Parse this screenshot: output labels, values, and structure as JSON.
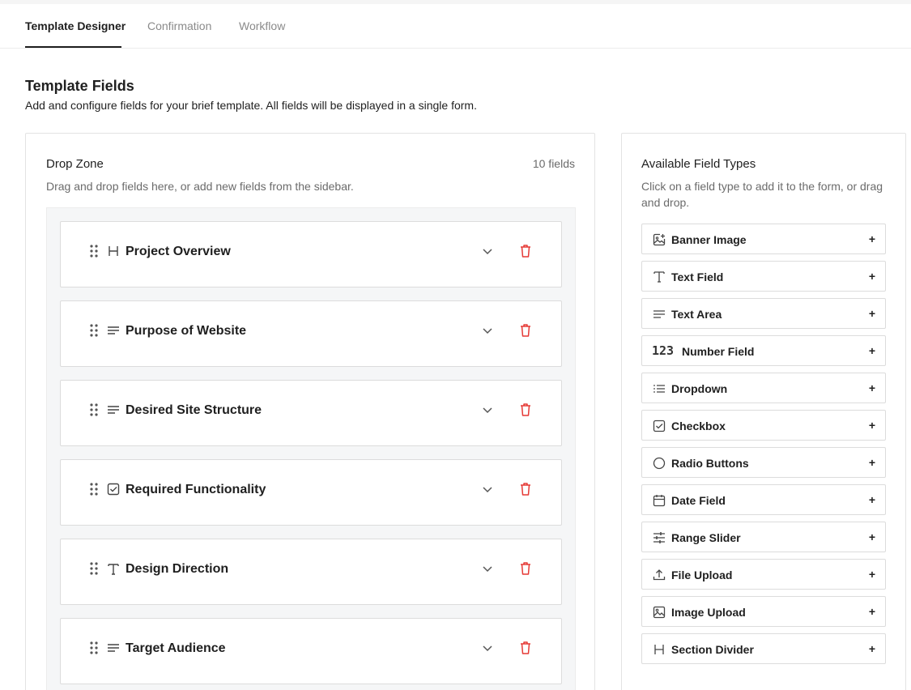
{
  "tabs": [
    {
      "label": "Template Designer",
      "active": true
    },
    {
      "label": "Confirmation",
      "active": false
    },
    {
      "label": "Workflow",
      "active": false
    }
  ],
  "header": {
    "title": "Template Fields",
    "subtitle": "Add and configure fields for your brief template. All fields will be displayed in a single form."
  },
  "drop_zone": {
    "title": "Drop Zone",
    "count": "10 fields",
    "description": "Drag and drop fields here, or add new fields from the sidebar.",
    "fields": [
      {
        "label": "Project Overview",
        "icon": "heading-icon"
      },
      {
        "label": "Purpose of Website",
        "icon": "text-area-icon"
      },
      {
        "label": "Desired Site Structure",
        "icon": "text-area-icon"
      },
      {
        "label": "Required Functionality",
        "icon": "checkbox-icon"
      },
      {
        "label": "Design Direction",
        "icon": "text-field-icon"
      },
      {
        "label": "Target Audience",
        "icon": "text-area-icon"
      }
    ]
  },
  "field_types": {
    "title": "Available Field Types",
    "description": "Click on a field type to add it to the form, or drag and drop.",
    "add_symbol": "+",
    "items": [
      {
        "label": "Banner Image",
        "icon": "banner-image-icon"
      },
      {
        "label": "Text Field",
        "icon": "text-field-icon"
      },
      {
        "label": "Text Area",
        "icon": "text-area-icon"
      },
      {
        "label": "Number Field",
        "icon": "number-icon",
        "icon_text": "123"
      },
      {
        "label": "Dropdown",
        "icon": "list-icon"
      },
      {
        "label": "Checkbox",
        "icon": "checkbox-icon"
      },
      {
        "label": "Radio Buttons",
        "icon": "radio-icon"
      },
      {
        "label": "Date Field",
        "icon": "calendar-icon"
      },
      {
        "label": "Range Slider",
        "icon": "sliders-icon"
      },
      {
        "label": "File Upload",
        "icon": "upload-icon"
      },
      {
        "label": "Image Upload",
        "icon": "image-icon"
      },
      {
        "label": "Section Divider",
        "icon": "heading-icon"
      }
    ]
  },
  "colors": {
    "accent": "#1f1f1f",
    "danger": "#e53935",
    "muted": "#6b6b6b"
  }
}
